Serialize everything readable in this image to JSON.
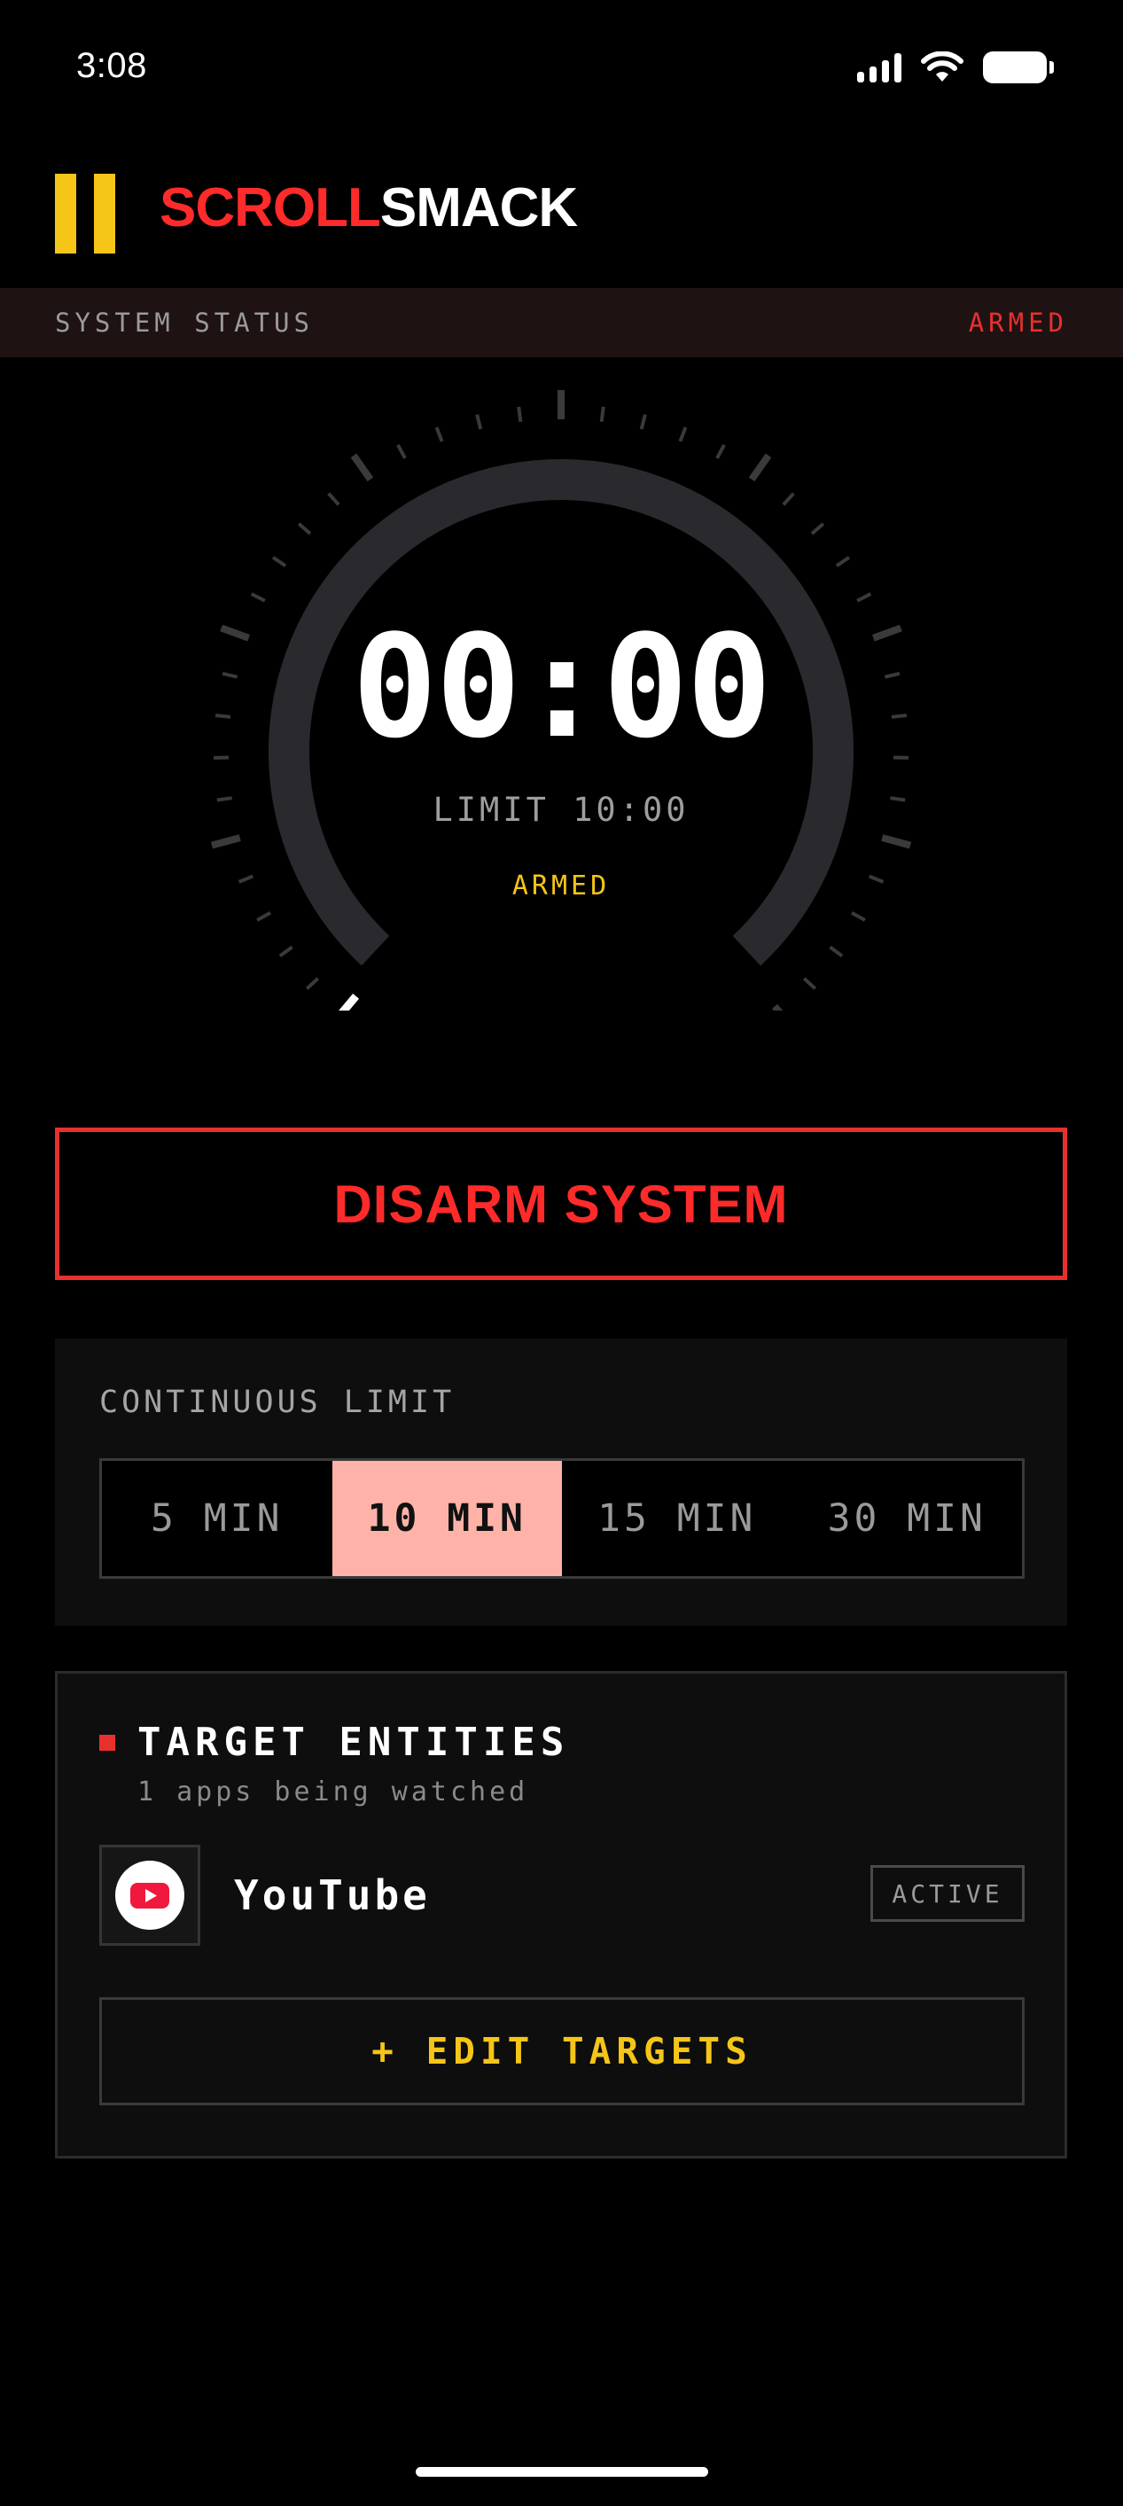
{
  "status_bar": {
    "time": "3:08",
    "icons": [
      "signal-icon",
      "wifi-icon",
      "battery-icon"
    ]
  },
  "header": {
    "icon": "pause-icon",
    "brand_part1": "SCROLL",
    "brand_part2": "SMACK"
  },
  "system_status": {
    "label": "SYSTEM STATUS",
    "value": "ARMED"
  },
  "dial": {
    "timer": "00:00",
    "limit_label": "LIMIT 10:00",
    "state": "ARMED",
    "progress": 0
  },
  "disarm_button": {
    "label": "DISARM SYSTEM"
  },
  "continuous_limit": {
    "title": "CONTINUOUS LIMIT",
    "options": [
      "5 MIN",
      "10 MIN",
      "15 MIN",
      "30 MIN"
    ],
    "selected": "10 MIN"
  },
  "targets": {
    "title": "TARGET ENTITIES",
    "subtitle": "1 apps being watched",
    "apps": [
      {
        "name": "YouTube",
        "status": "ACTIVE",
        "icon": "youtube-icon"
      }
    ],
    "edit_label": "+ EDIT TARGETS"
  },
  "colors": {
    "accent_red": "#e8302f",
    "accent_yellow": "#f5c518",
    "selected_pink": "#ffb3a8",
    "background": "#000000",
    "card": "#0e0e0e"
  }
}
